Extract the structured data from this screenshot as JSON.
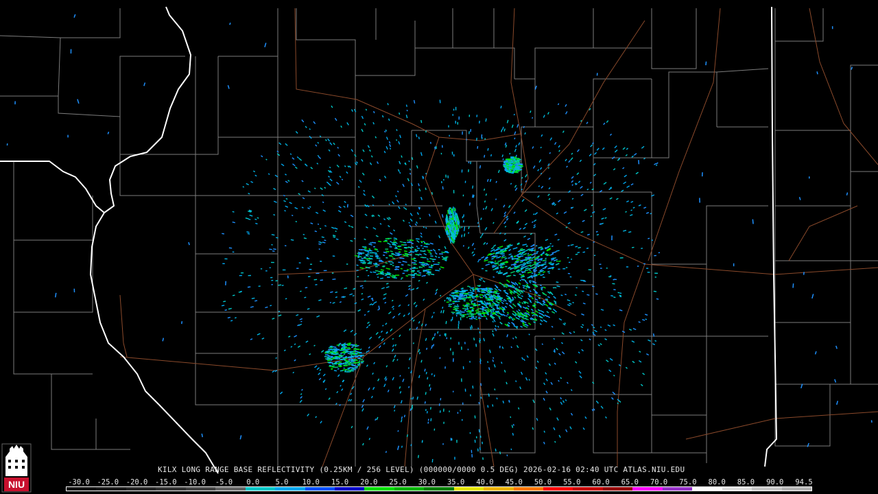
{
  "caption": {
    "text": "KILX LONG RANGE BASE REFLECTIVITY (0.25KM / 256 LEVEL) (000000/0000 0.5 DEG) 2026-02-16 02:40 UTC  ATLAS.NIU.EDU"
  },
  "logo": {
    "text": "NIU",
    "color": "#c8102e"
  },
  "colorbar": {
    "labels": [
      "-30.0",
      "-25.0",
      "-20.0",
      "-15.0",
      "-10.0",
      "-5.0",
      "0.0",
      "5.0",
      "10.0",
      "15.0",
      "20.0",
      "25.0",
      "30.0",
      "35.0",
      "40.0",
      "45.0",
      "50.0",
      "55.0",
      "60.0",
      "65.0",
      "70.0",
      "75.0",
      "80.0",
      "85.0",
      "90.0",
      "94.5"
    ],
    "colors": [
      "#111111",
      "#1a1a1a",
      "#262626",
      "#333333",
      "#444444",
      "#666666",
      "#00c8c8",
      "#00a8f0",
      "#0050ff",
      "#0000c8",
      "#00e000",
      "#00b400",
      "#008000",
      "#e6e600",
      "#f0b400",
      "#ff7800",
      "#ff0000",
      "#c80000",
      "#960000",
      "#ff00ff",
      "#9632c8",
      "#ffffff",
      "#e0e0e0",
      "#c8c8c8",
      "#b4b4b4"
    ]
  },
  "map_colors": {
    "background": "#000000",
    "county_lines": "#8a8a8a",
    "state_lines": "#ffffff",
    "highways": "#8b4a2b"
  }
}
